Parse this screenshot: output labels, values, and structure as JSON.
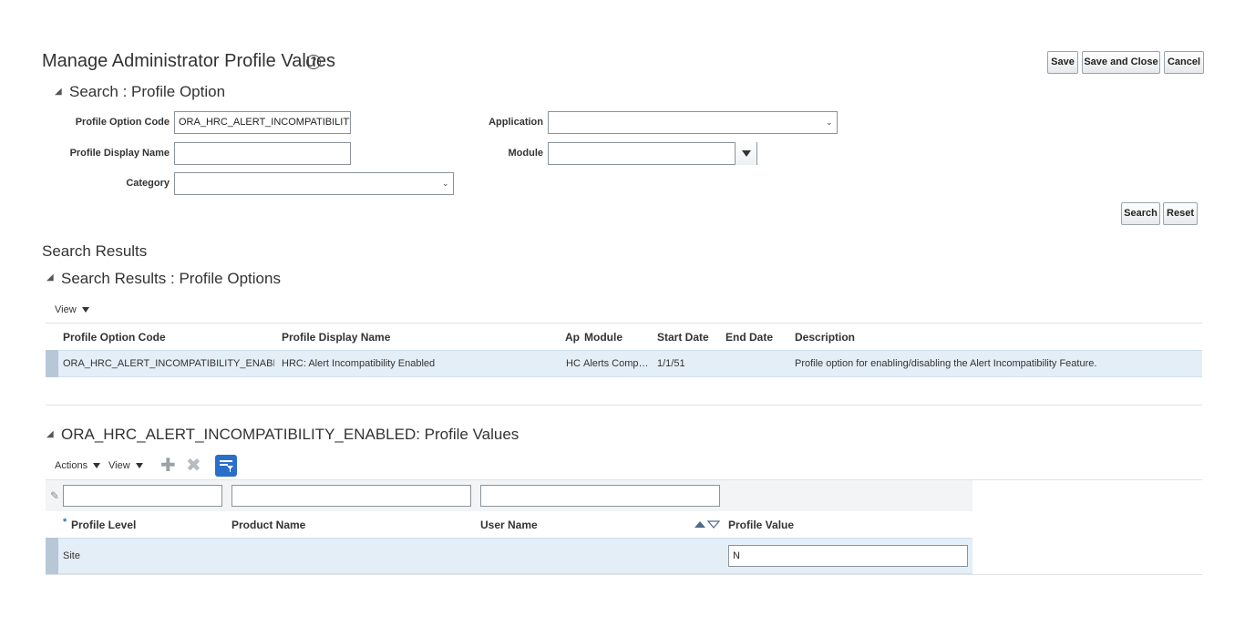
{
  "header": {
    "title": "Manage Administrator Profile Values",
    "help_glyph": "?",
    "save_label": "Save",
    "save_close_label": "Save and Close",
    "cancel_label": "Cancel"
  },
  "search": {
    "title": "Search : Profile Option",
    "profile_option_code_label": "Profile Option Code",
    "profile_option_code_value": "ORA_HRC_ALERT_INCOMPATIBILITY_",
    "profile_display_name_label": "Profile Display Name",
    "profile_display_name_value": "",
    "category_label": "Category",
    "category_value": "",
    "application_label": "Application",
    "application_value": "",
    "module_label": "Module",
    "module_value": "",
    "search_label": "Search",
    "reset_label": "Reset"
  },
  "results": {
    "heading": "Search Results",
    "title": "Search Results : Profile Options",
    "view_label": "View",
    "columns": [
      "Profile Option Code",
      "Profile Display Name",
      "Ap",
      "Module",
      "Start Date",
      "End Date",
      "Description"
    ],
    "rows": [
      {
        "code": "ORA_HRC_ALERT_INCOMPATIBILITY_ENABL…",
        "display_name": "HRC: Alert Incompatibility Enabled",
        "ap": "HC",
        "module": "Alerts Comp…",
        "start_date": "1/1/51",
        "end_date": "",
        "description": "Profile option for enabling/disabling the Alert Incompatibility Feature."
      }
    ]
  },
  "values": {
    "title": "ORA_HRC_ALERT_INCOMPATIBILITY_ENABLED: Profile Values",
    "actions_label": "Actions",
    "view_label": "View",
    "required_mark": "*",
    "columns": [
      "Profile Level",
      "Product Name",
      "User Name",
      "Profile Value"
    ],
    "filters": [
      "",
      "",
      ""
    ],
    "rows": [
      {
        "level": "Site",
        "product": "",
        "user": "",
        "value": "N"
      }
    ]
  },
  "colors": {
    "accent": "#2a6fc9",
    "row_selected": "#e4eef7"
  }
}
